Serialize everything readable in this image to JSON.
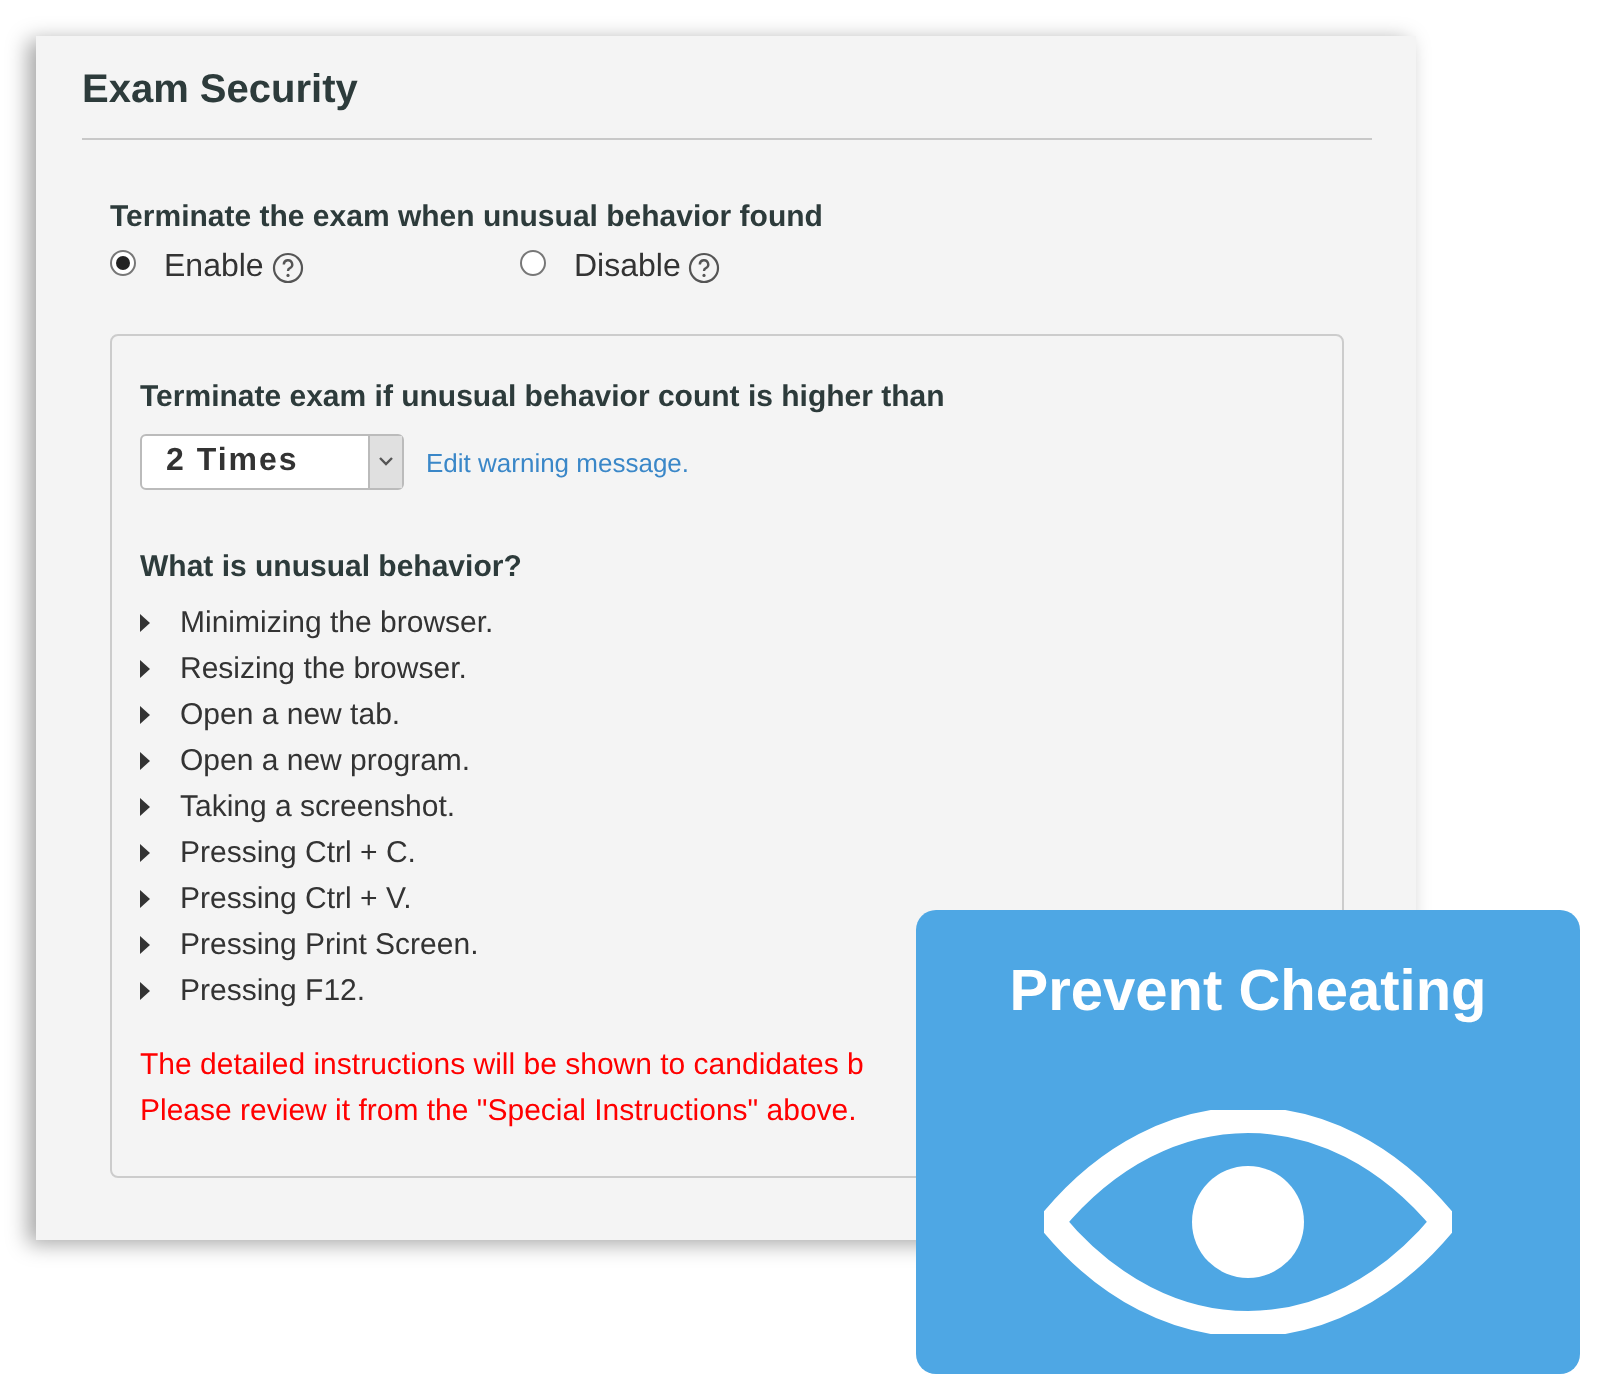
{
  "panel": {
    "title": "Exam Security"
  },
  "terminate": {
    "label": "Terminate the exam when unusual behavior found",
    "options": [
      {
        "label": "Enable",
        "selected": true
      },
      {
        "label": "Disable",
        "selected": false
      }
    ]
  },
  "box": {
    "label": "Terminate exam if unusual behavior count is higher than",
    "select_value": "2 Times",
    "link": "Edit warning message.",
    "heading": "What is unusual behavior?",
    "behaviors": [
      "Minimizing the browser.",
      "Resizing the browser.",
      "Open a new tab.",
      "Open a new program.",
      "Taking a screenshot.",
      "Pressing Ctrl + C.",
      "Pressing Ctrl + V.",
      "Pressing Print Screen.",
      "Pressing F12."
    ],
    "notes": [
      "The detailed instructions will be shown to candidates b",
      "Please review it from the \"Special Instructions\" above."
    ]
  },
  "overlay": {
    "title": "Prevent Cheating"
  }
}
